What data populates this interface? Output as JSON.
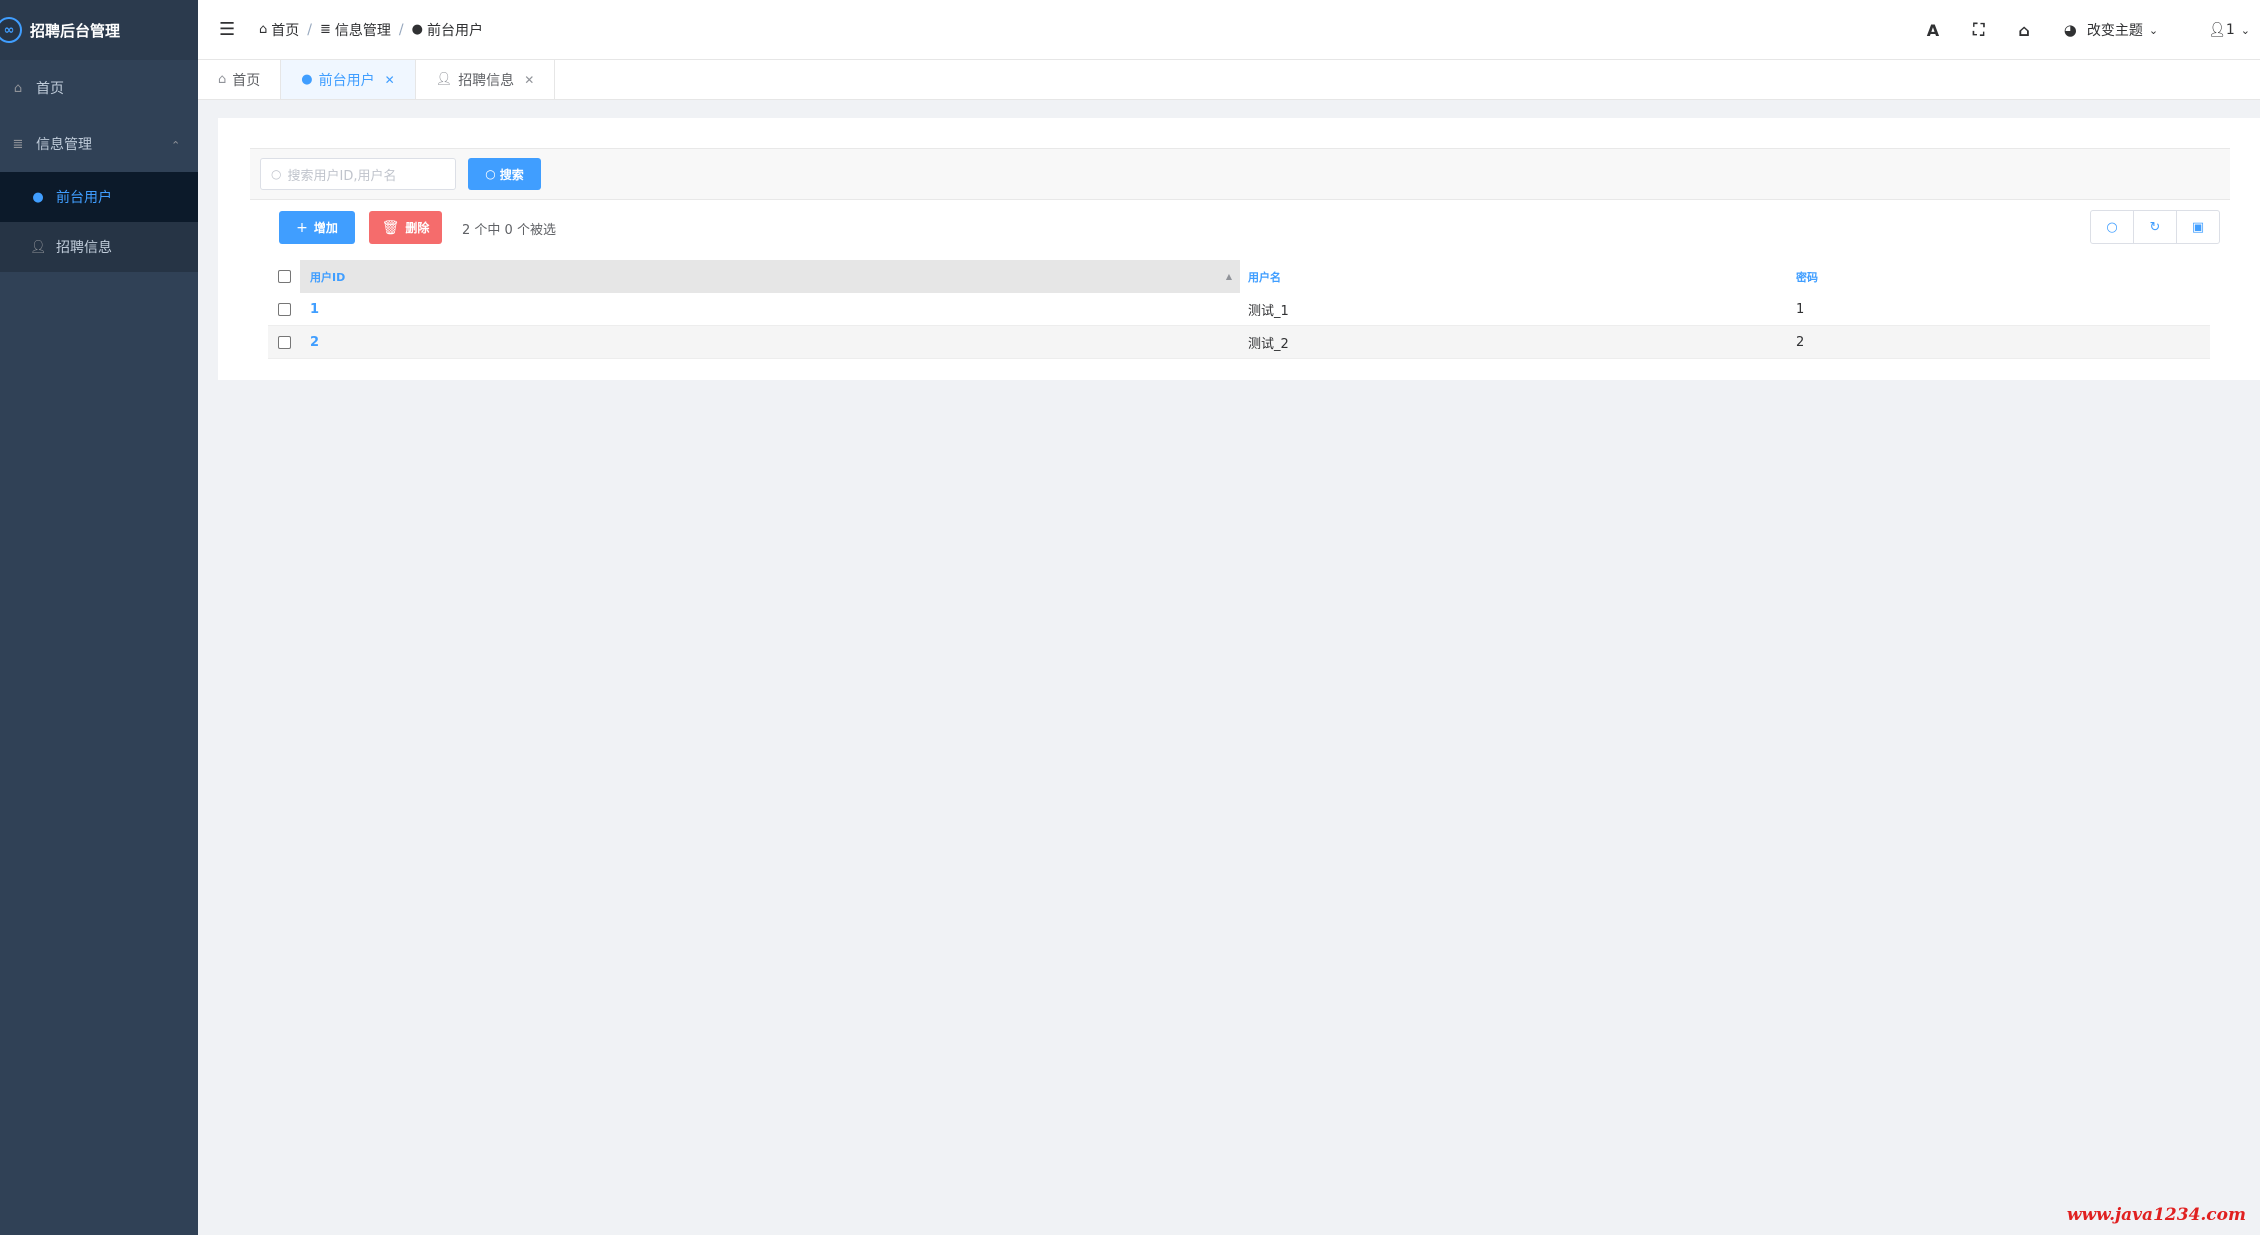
{
  "app": {
    "title": "招聘后台管理",
    "logo_glyph": "∞"
  },
  "sidebar": {
    "items": [
      {
        "label": "首页",
        "icon": "home-icon"
      },
      {
        "label": "信息管理",
        "icon": "database-icon"
      },
      {
        "label": "前台用户",
        "icon": "apple-icon",
        "active": true
      },
      {
        "label": "招聘信息",
        "icon": "user-icon"
      }
    ]
  },
  "navbar": {
    "breadcrumb": [
      "首页",
      "信息管理",
      "前台用户"
    ],
    "theme_label": "改变主题",
    "user_label": "1"
  },
  "tabs": [
    {
      "label": "首页"
    },
    {
      "label": "前台用户",
      "active": true
    },
    {
      "label": "招聘信息"
    }
  ],
  "search": {
    "placeholder": "搜索用户ID,用户名",
    "button_label": "搜索"
  },
  "toolbar": {
    "add_label": "增加",
    "delete_label": "删除",
    "selection_info": "2 个中 0 个被选"
  },
  "table": {
    "columns": [
      "用户ID",
      "用户名",
      "密码"
    ],
    "rows": [
      {
        "id": "1",
        "name": "测试_1",
        "password": "1"
      },
      {
        "id": "2",
        "name": "测试_2",
        "password": "2"
      }
    ]
  },
  "watermark": "www.java1234.com",
  "colors": {
    "primary": "#409eff",
    "danger": "#f56c6c",
    "sidebar": "#304156"
  }
}
